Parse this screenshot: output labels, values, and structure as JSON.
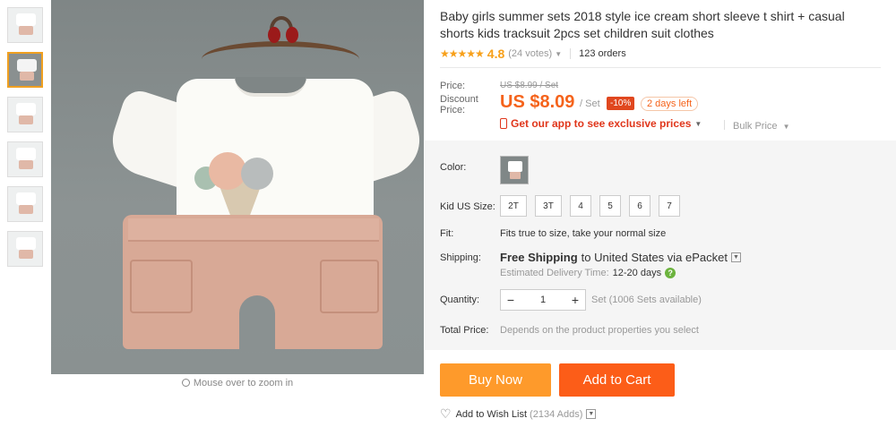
{
  "gallery": {
    "thumbnail_count": 6,
    "active_index": 1,
    "zoom_hint": "Mouse over to zoom in"
  },
  "product": {
    "title": "Baby girls summer sets 2018 style ice cream short sleeve t shirt + casual shorts kids tracksuit 2pcs set children suit clothes",
    "rating": {
      "stars": "★★★★★",
      "value": "4.8",
      "votes": "(24 votes)",
      "orders": "123 orders"
    }
  },
  "price": {
    "price_label": "Price:",
    "old_price": "US $8.99 / Set",
    "discount_label": "Discount Price:",
    "new_price": "US $8.09",
    "per_unit": "/ Set",
    "discount_badge": "-10%",
    "time_left": "2 days left",
    "app_promo": "Get our app to see exclusive prices",
    "bulk_price": "Bulk Price"
  },
  "options": {
    "color_label": "Color:",
    "size_label": "Kid US Size:",
    "sizes": [
      "2T",
      "3T",
      "4",
      "5",
      "6",
      "7"
    ],
    "fit_label": "Fit:",
    "fit_text": "Fits true to size, take your normal size",
    "shipping_label": "Shipping:",
    "shipping_free": "Free Shipping",
    "shipping_dest": "to United States via ePacket",
    "delivery_label": "Estimated Delivery Time:",
    "delivery_days": "12-20 days",
    "quantity_label": "Quantity:",
    "quantity_value": "1",
    "quantity_available": "Set (1006 Sets available)",
    "total_label": "Total Price:",
    "total_value": "Depends on the product properties you select"
  },
  "actions": {
    "buy_now": "Buy Now",
    "add_to_cart": "Add to Cart",
    "wish_list": "Add to Wish List",
    "wish_count": "(2134 Adds)"
  },
  "colors": {
    "accent_orange": "#f5631b",
    "buy_button": "#fe9a2b",
    "cart_button": "#fc5d18",
    "star": "#f7a01a"
  }
}
